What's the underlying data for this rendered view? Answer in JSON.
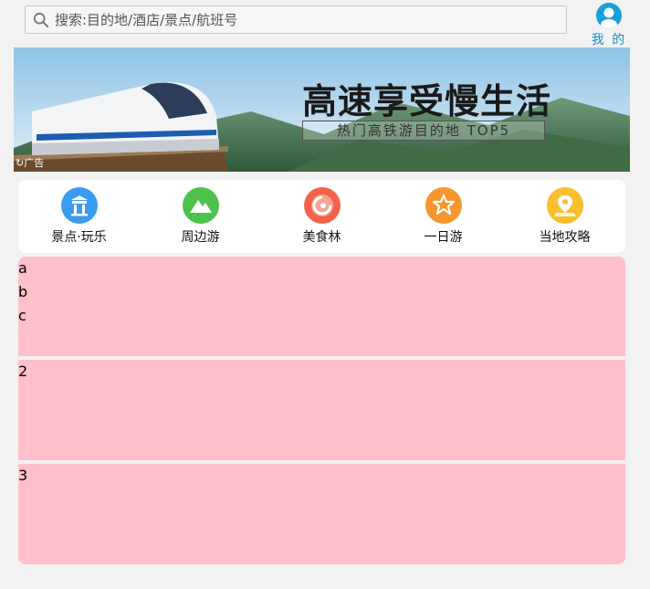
{
  "search": {
    "placeholder": "搜索:目的地/酒店/景点/航班号"
  },
  "user": {
    "label": "我 的"
  },
  "banner": {
    "title": "高速享受慢生活",
    "subtitle": "热门高铁游目的地 TOP5",
    "ad_label": "广告"
  },
  "nav": {
    "items": [
      {
        "label": "景点·玩乐",
        "icon": "pavilion-icon",
        "color": "#3a9bf0"
      },
      {
        "label": "周边游",
        "icon": "mountain-icon",
        "color": "#4cc24c"
      },
      {
        "label": "美食林",
        "icon": "food-icon",
        "color": "#f3634a"
      },
      {
        "label": "一日游",
        "icon": "star-badge-icon",
        "color": "#f6962e"
      },
      {
        "label": "当地攻略",
        "icon": "map-pin-icon",
        "color": "#fbbe2e"
      }
    ]
  },
  "blocks": {
    "first": {
      "lines": [
        "a",
        "b",
        "c"
      ]
    },
    "second": {
      "text": "2"
    },
    "third": {
      "text": "3"
    }
  },
  "colors": {
    "block_bg": "#ffc0cb",
    "accent": "#1aa0d8"
  }
}
